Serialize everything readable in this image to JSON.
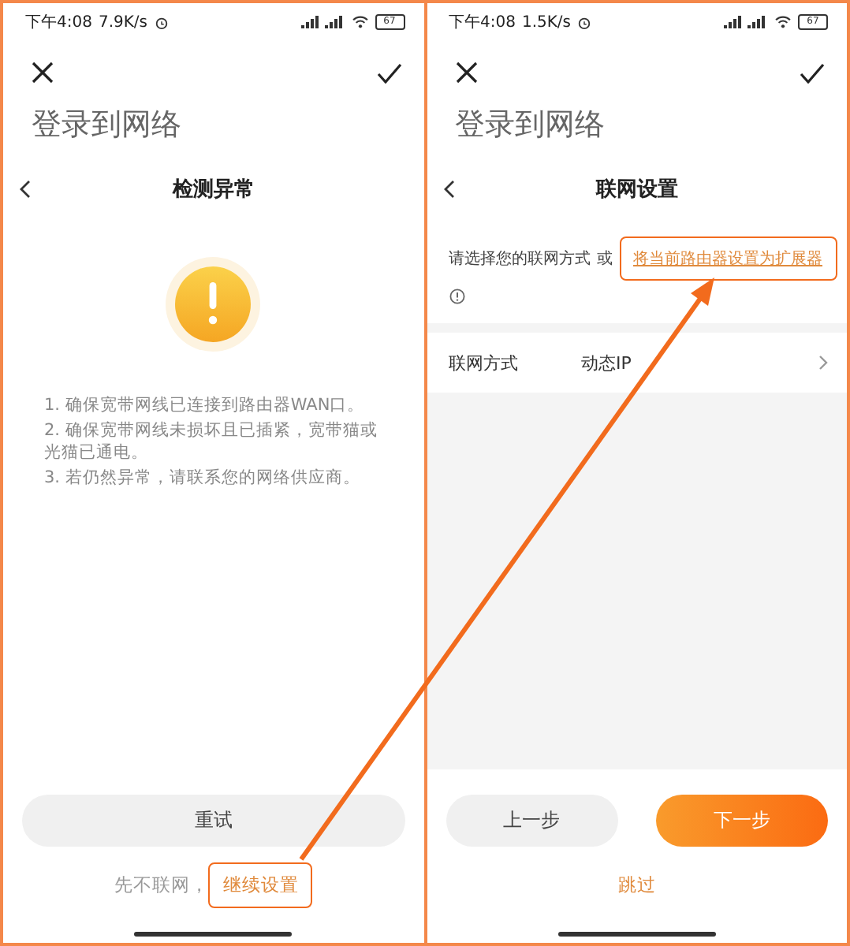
{
  "left_screen": {
    "status_bar": {
      "time": "下午4:08",
      "speed": "7.9K/s",
      "battery": "67"
    },
    "page_title": "登录到网络",
    "header": "检测异常",
    "tips": [
      "1. 确保宽带网线已连接到路由器WAN口。",
      "2. 确保宽带网线未损坏且已插紧，宽带猫或光猫已通电。",
      "3. 若仍然异常，请联系您的网络供应商。"
    ],
    "retry_button": "重试",
    "footer_prefix": "先不联网，",
    "footer_link": {
      "label": "继续设置",
      "highlighted": true
    }
  },
  "right_screen": {
    "status_bar": {
      "time": "下午4:08",
      "speed": "1.5K/s",
      "battery": "67"
    },
    "page_title": "登录到网络",
    "header": "联网设置",
    "prompt": "请选择您的联网方式",
    "or_text": "或",
    "extender_link": {
      "label": "将当前路由器设置为扩展器",
      "highlighted": true
    },
    "setting_row": {
      "label": "联网方式",
      "value": "动态IP"
    },
    "prev_button": "上一步",
    "next_button": "下一步",
    "skip_link": "跳过"
  },
  "annotation_arrow": true
}
